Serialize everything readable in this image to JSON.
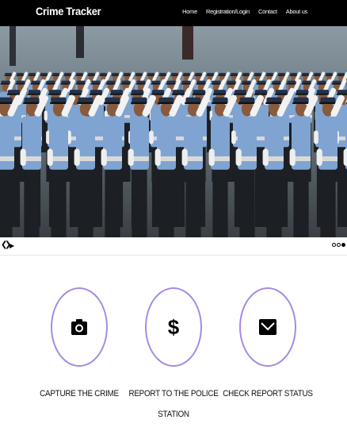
{
  "navbar": {
    "brand": "Crime Tracker",
    "links": [
      "Home",
      "Registration/Login",
      "Contact",
      "About us"
    ]
  },
  "carousel": {
    "image": "parade-officers-saluting",
    "controls": {
      "prev": "❮",
      "next": "❯",
      "play": "▶"
    },
    "slides": 3,
    "active_slide": 3
  },
  "features": [
    {
      "label": "CAPTURE THE CRIME",
      "icon": "camera-icon"
    },
    {
      "label": "REPORT TO THE POLICE STATION",
      "icon": "dollar-icon"
    },
    {
      "label": "CHECK REPORT STATUS",
      "icon": "envelope-icon"
    }
  ],
  "colors": {
    "navbar_bg": "#000000",
    "circle_border": "#a48be0",
    "uniform_blue": "#7fa4d1"
  }
}
